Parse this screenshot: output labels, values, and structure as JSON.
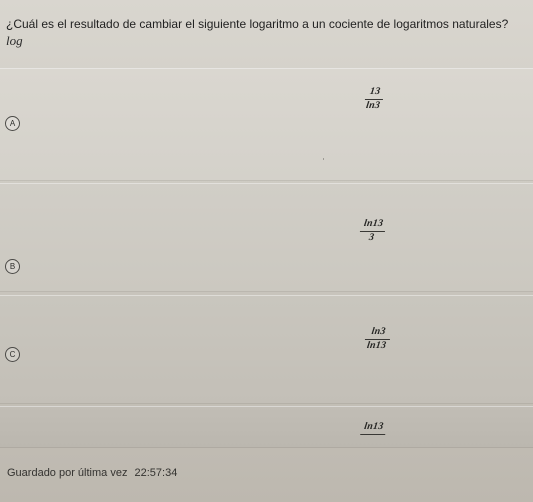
{
  "question": {
    "text": "¿Cuál es el resultado de cambiar el siguiente logaritmo a un cociente de logaritmos naturales?",
    "expression": "log"
  },
  "options": [
    {
      "letter": "A",
      "numerator": "13",
      "denominator": "ln3"
    },
    {
      "letter": "B",
      "numerator": "ln13",
      "denominator": "3"
    },
    {
      "letter": "C",
      "numerator": "ln3",
      "denominator": "ln13"
    },
    {
      "letter": "",
      "numerator": "ln13",
      "denominator": ""
    }
  ],
  "footer": {
    "saved_label": "Guardado por última vez",
    "saved_time": "22:57:34"
  },
  "colors": {
    "background": "#c7c3bb",
    "text": "#2b2a28"
  }
}
